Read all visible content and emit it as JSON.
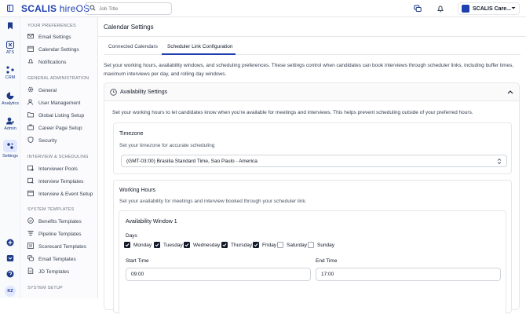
{
  "app": {
    "logo_main": "SCALIS",
    "logo_sub": "hireOS"
  },
  "search": {
    "placeholder": "Job Title"
  },
  "account": {
    "name": "SCALIS Care..."
  },
  "rail": [
    {
      "label": "",
      "icon": "bookmark-icon"
    },
    {
      "label": "ATS",
      "icon": "ats-icon"
    },
    {
      "label": "CRM",
      "icon": "crm-icon"
    },
    {
      "label": "Analytics",
      "icon": "analytics-icon"
    },
    {
      "label": "Admin",
      "icon": "admin-icon"
    },
    {
      "label": "Settings",
      "icon": "settings-icon"
    }
  ],
  "user_initials": "KZ",
  "sidebar": {
    "sections": [
      {
        "title": "YOUR PREFERENCES",
        "items": [
          "Email Settings",
          "Calendar Settings",
          "Notifications"
        ]
      },
      {
        "title": "GENERAL ADMINISTRATION",
        "items": [
          "General",
          "User Management",
          "Global Listing Setup",
          "Career Page Setup",
          "Security"
        ]
      },
      {
        "title": "INTERVIEW & SCHEDULING",
        "items": [
          "Interviewer Pools",
          "Interview Templates",
          "Interview & Event Setup"
        ]
      },
      {
        "title": "SYSTEM TEMPLATES",
        "items": [
          "Benefits Templates",
          "Pipeline Templates",
          "Scorecard Templates",
          "Email Templates",
          "JD Templates"
        ]
      },
      {
        "title": "SYSTEM SETUP",
        "items": []
      }
    ]
  },
  "main": {
    "title": "Calendar Settings",
    "tabs": [
      "Connected Calendars",
      "Scheduler Link Configuration"
    ],
    "intro": "Set your working hours, availability windows, and scheduling preferences. These settings control when candidates can book interviews through scheduler links, including buffer times, maximum interviews per day, and rolling day windows.",
    "availability": {
      "title": "Availability Settings",
      "desc": "Set your working hours to let candidates know when you're available for meetings and interviews. This helps prevent scheduling outside of your preferred hours.",
      "timezone": {
        "title": "Timezone",
        "desc": "Set your timezone for accurate scheduling",
        "value": "(GMT-03:00) Brasilia Standard Time, Sao Paulo - America"
      },
      "working_hours": {
        "title": "Working Hours",
        "desc": "Set your availability for meetings and interview booked through your scheduler link.",
        "window": {
          "title": "Availability Window 1",
          "days_label": "Days",
          "days": [
            {
              "name": "Monday",
              "checked": true
            },
            {
              "name": "Tuesday",
              "checked": true
            },
            {
              "name": "Wednesday",
              "checked": true
            },
            {
              "name": "Thursday",
              "checked": true
            },
            {
              "name": "Friday",
              "checked": true
            },
            {
              "name": "Saturday",
              "checked": false
            },
            {
              "name": "Sunday",
              "checked": false
            }
          ],
          "start_label": "Start Time",
          "start_value": "09:00",
          "end_label": "End Time",
          "end_value": "17:00"
        }
      }
    }
  }
}
